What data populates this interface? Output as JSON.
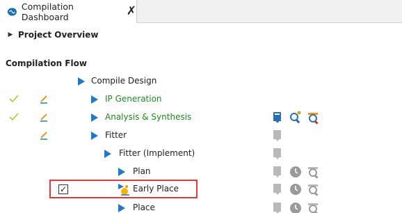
{
  "tab": {
    "title": "Compilation Dashboard",
    "close_symbol": "✗"
  },
  "project_overview": {
    "label": "Project Overview"
  },
  "flow": {
    "header": "Compilation Flow",
    "tasks": [
      {
        "label": "Compile Design",
        "status": "none"
      },
      {
        "label": "IP Generation",
        "status": "done"
      },
      {
        "label": "Analysis & Synthesis",
        "status": "done"
      },
      {
        "label": "Fitter",
        "status": "pending"
      },
      {
        "label": "Fitter (Implement)",
        "status": "none"
      },
      {
        "label": "Plan",
        "status": "none"
      },
      {
        "label": "Early Place",
        "status": "selected",
        "checked": "✓"
      },
      {
        "label": "Place",
        "status": "none"
      }
    ]
  },
  "colors": {
    "accent_blue": "#1f7acb",
    "done_green": "#1e8a1e",
    "highlight_red": "#e03a3a"
  }
}
